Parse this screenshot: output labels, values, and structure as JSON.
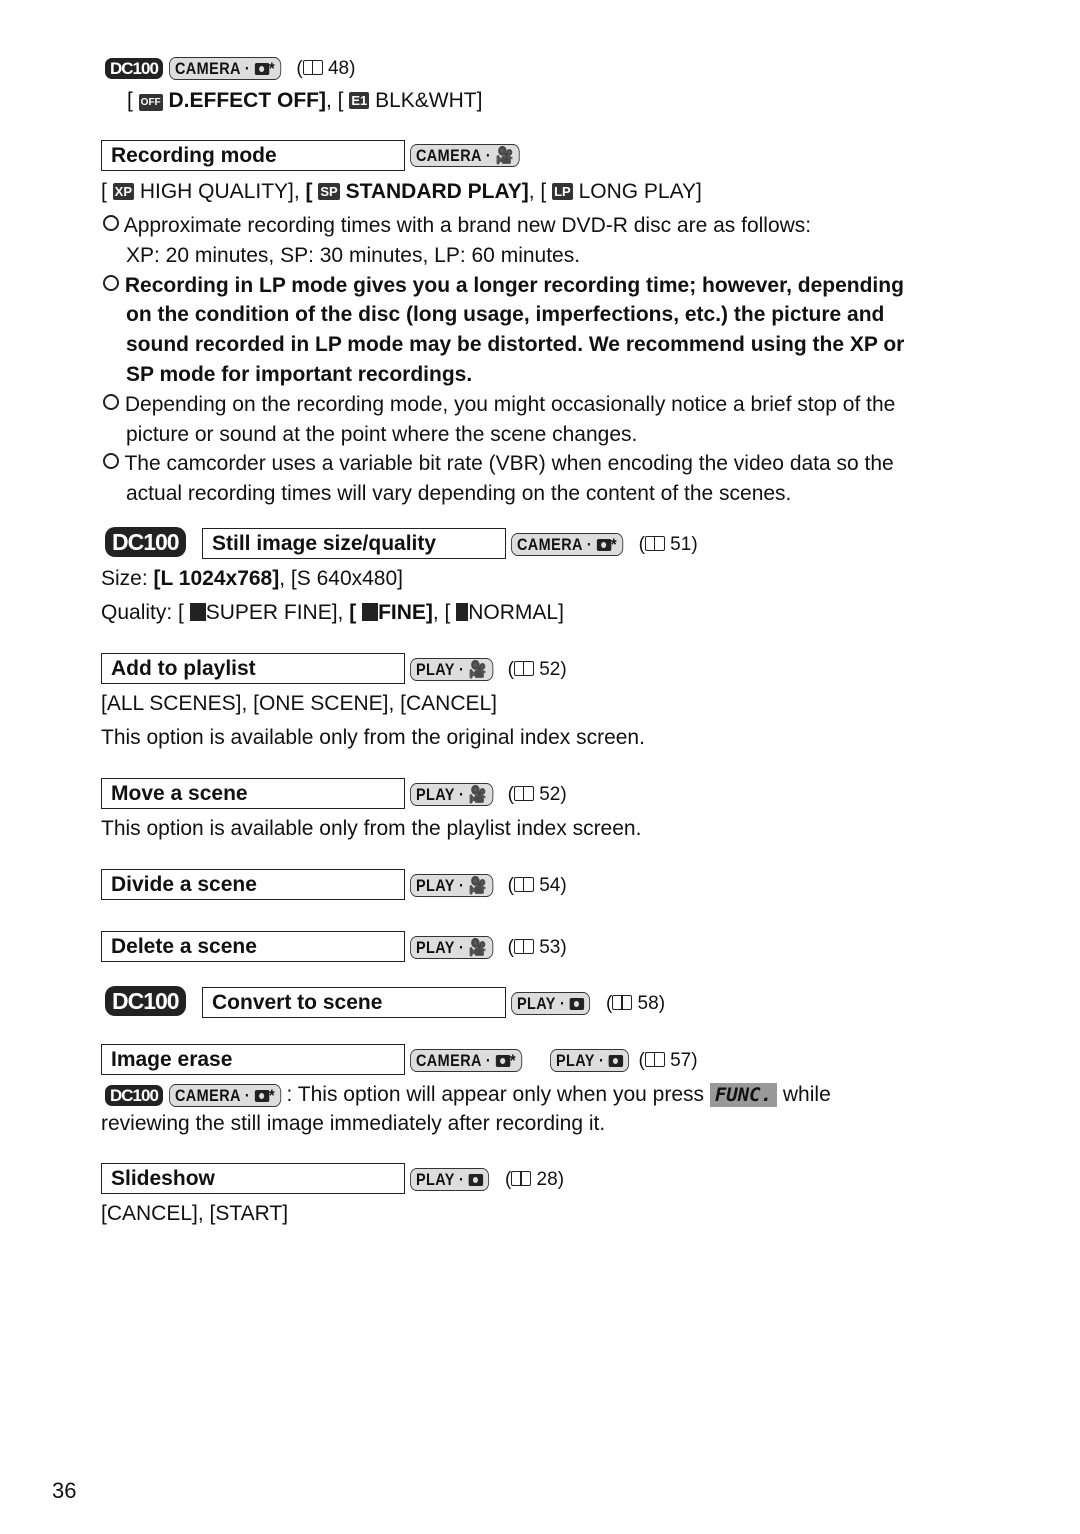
{
  "top": {
    "model_badge": "DC100",
    "mode": "CAMERA · ",
    "ref": "48",
    "options_prefix": "[ ",
    "opt1": "D.EFFECT OFF]",
    "sep": ", [ ",
    "opt2_icon": "E1",
    "opt2": "BLK&WHT]"
  },
  "recording_mode": {
    "title": "Recording mode",
    "mode": "CAMERA · ",
    "opt_xp_icon": "XP",
    "opt_xp": "HIGH QUALITY],",
    "opt_sp_icon": "SP",
    "opt_sp": "STANDARD PLAY]",
    "opt_lp_icon": "LP",
    "opt_lp": "LONG PLAY]",
    "bullets": [
      {
        "lines": [
          "Approximate recording times with a brand new DVD-R disc are as follows:",
          "XP: 20 minutes, SP: 30 minutes, LP: 60 minutes."
        ],
        "bold": false
      },
      {
        "lines": [
          "Recording in LP mode gives you a longer recording time; however, depending",
          "on the condition of the disc (long usage, imperfections, etc.) the picture and",
          "sound recorded in LP mode may be distorted. We recommend using the XP or",
          "SP mode for important recordings."
        ],
        "bold": true
      },
      {
        "lines": [
          "Depending on the recording mode, you might occasionally notice a brief stop of the",
          "picture or sound at the point where the scene changes."
        ],
        "bold": false
      },
      {
        "lines": [
          "The camcorder uses a variable bit rate (VBR) when encoding the video data so the",
          "actual recording times will vary depending on the content of the scenes."
        ],
        "bold": false
      }
    ]
  },
  "still_image": {
    "badge": "DC100",
    "title": "Still image size/quality",
    "mode": "CAMERA · ",
    "ref": "51",
    "size_label": "Size: ",
    "size_l": "[L 1024x768]",
    "size_s": ", [S 640x480]",
    "quality_label": "Quality: [ ",
    "q1": "SUPER FINE], ",
    "q2": "[ ",
    "q2b": "FINE]",
    "q3": ", [ ",
    "q3b": "NORMAL]"
  },
  "playlist": {
    "title": "Add to playlist",
    "mode": "PLAY · ",
    "ref": "52",
    "options": "[ALL SCENES], [ONE SCENE], [CANCEL]",
    "note": "This option is available only from the original index screen."
  },
  "move": {
    "title": "Move a scene",
    "mode": "PLAY · ",
    "ref": "52",
    "note": "This option is available only from the playlist index screen."
  },
  "divide": {
    "title": "Divide a scene",
    "mode": "PLAY · ",
    "ref": "54"
  },
  "delete": {
    "title": "Delete a scene",
    "mode": "PLAY · ",
    "ref": "53"
  },
  "convert": {
    "badge": "DC100",
    "title": "Convert to scene",
    "mode": "PLAY · ",
    "ref": "58"
  },
  "erase": {
    "title": "Image erase",
    "mode1": "CAMERA · ",
    "mode2": "PLAY · ",
    "ref": "57",
    "badge": "DC100",
    "note_a": ": This option will appear only when you press",
    "func": "FUNC.",
    "note_b": "while",
    "note_c": "reviewing the still image immediately after recording it."
  },
  "slideshow": {
    "title": "Slideshow",
    "mode": "PLAY · ",
    "ref": "28",
    "options": "[CANCEL], [START]"
  },
  "page_number": "36"
}
